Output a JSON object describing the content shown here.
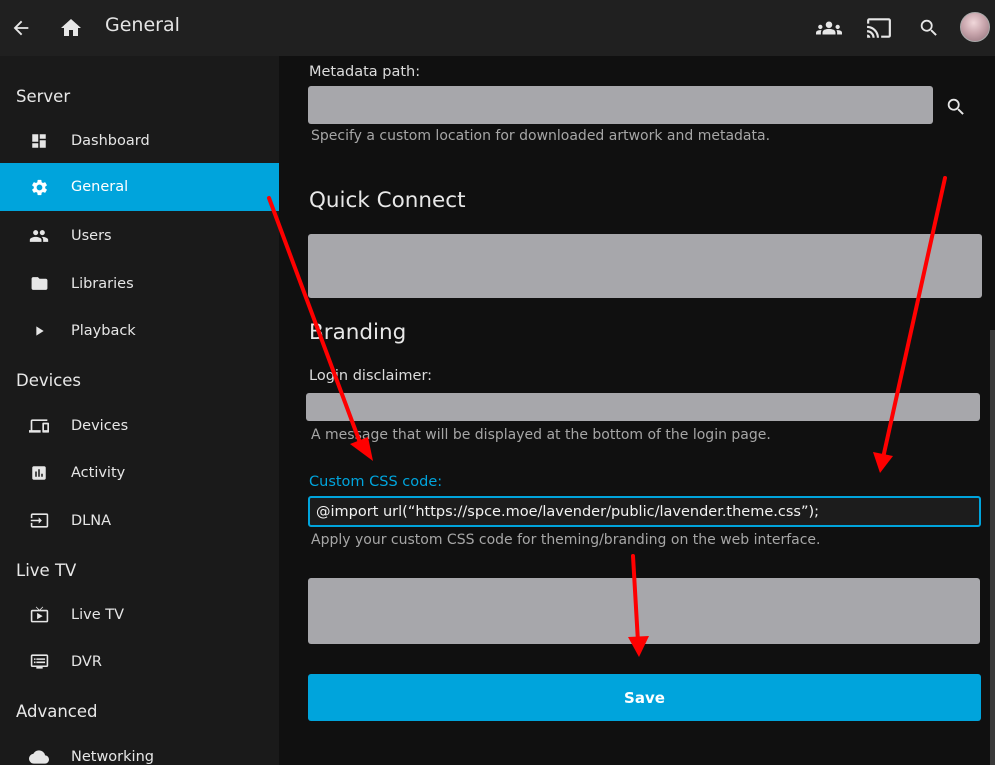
{
  "header": {
    "title": "General",
    "icons": [
      "back-arrow-icon",
      "home-icon",
      "users-group-icon",
      "cast-icon",
      "search-icon",
      "avatar"
    ]
  },
  "sidebar": {
    "sections": [
      {
        "title": "Server",
        "items": [
          {
            "label": "Dashboard",
            "icon": "dashboard-icon"
          },
          {
            "label": "General",
            "icon": "gear-icon",
            "active": true
          },
          {
            "label": "Users",
            "icon": "people-icon"
          },
          {
            "label": "Libraries",
            "icon": "folder-icon"
          },
          {
            "label": "Playback",
            "icon": "play-icon"
          }
        ]
      },
      {
        "title": "Devices",
        "items": [
          {
            "label": "Devices",
            "icon": "devices-icon"
          },
          {
            "label": "Activity",
            "icon": "activity-icon"
          },
          {
            "label": "DLNA",
            "icon": "dlna-icon"
          }
        ]
      },
      {
        "title": "Live TV",
        "items": [
          {
            "label": "Live TV",
            "icon": "live-tv-icon"
          },
          {
            "label": "DVR",
            "icon": "dvr-icon"
          }
        ]
      },
      {
        "title": "Advanced",
        "items": [
          {
            "label": "Networking",
            "icon": "cloud-icon"
          }
        ]
      }
    ]
  },
  "main": {
    "metadata_path": {
      "label": "Metadata path:",
      "value": "",
      "help": "Specify a custom location for downloaded artwork and metadata."
    },
    "quick_connect": {
      "heading": "Quick Connect"
    },
    "branding": {
      "heading": "Branding",
      "login_disclaimer": {
        "label": "Login disclaimer:",
        "value": "",
        "help": "A message that will be displayed at the bottom of the login page."
      },
      "custom_css": {
        "label": "Custom CSS code:",
        "value": "@import url(“https://spce.moe/lavender/public/lavender.theme.css”);",
        "help": "Apply your custom CSS code for theming/branding on the web interface."
      }
    },
    "save_label": "Save"
  },
  "colors": {
    "accent": "#00a4dc",
    "annotation_arrow": "#ff0000",
    "redacted_field": "#a7a7ab"
  }
}
